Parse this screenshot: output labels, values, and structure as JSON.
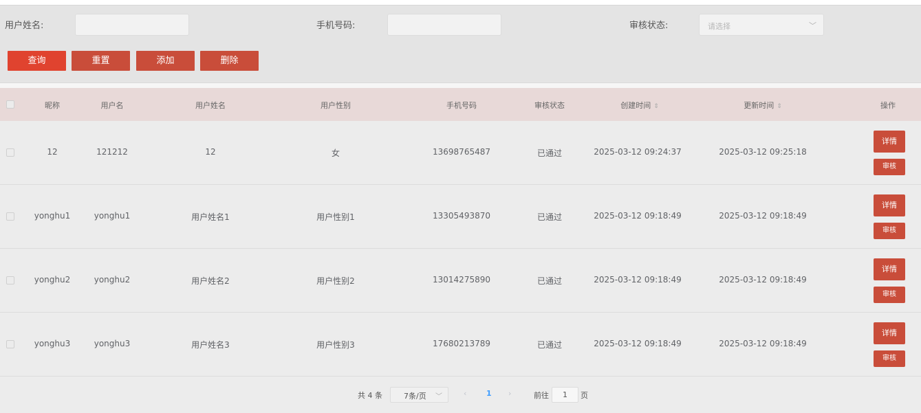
{
  "filters": {
    "username_label": "用户姓名:",
    "phone_label": "手机号码:",
    "status_label": "审核状态:",
    "status_placeholder": "请选择"
  },
  "buttons": {
    "query": "查询",
    "reset": "重置",
    "add": "添加",
    "delete": "删除"
  },
  "table": {
    "headers": {
      "nickname": "昵称",
      "username": "用户名",
      "realname": "用户姓名",
      "gender": "用户性别",
      "phone": "手机号码",
      "status": "审核状态",
      "created": "创建时间",
      "updated": "更新时间",
      "ops": "操作"
    },
    "sort_icon": "⇕",
    "detail_label": "详情",
    "audit_label": "审核",
    "rows": [
      {
        "nickname": "12",
        "username": "121212",
        "realname": "12",
        "gender": "女",
        "phone": "13698765487",
        "status": "已通过",
        "created": "2025-03-12 09:24:37",
        "updated": "2025-03-12 09:25:18"
      },
      {
        "nickname": "yonghu1",
        "username": "yonghu1",
        "realname": "用户姓名1",
        "gender": "用户性别1",
        "phone": "13305493870",
        "status": "已通过",
        "created": "2025-03-12 09:18:49",
        "updated": "2025-03-12 09:18:49"
      },
      {
        "nickname": "yonghu2",
        "username": "yonghu2",
        "realname": "用户姓名2",
        "gender": "用户性别2",
        "phone": "13014275890",
        "status": "已通过",
        "created": "2025-03-12 09:18:49",
        "updated": "2025-03-12 09:18:49"
      },
      {
        "nickname": "yonghu3",
        "username": "yonghu3",
        "realname": "用户姓名3",
        "gender": "用户性别3",
        "phone": "17680213789",
        "status": "已通过",
        "created": "2025-03-12 09:18:49",
        "updated": "2025-03-12 09:18:49"
      }
    ]
  },
  "pagination": {
    "total_text": "共 4 条",
    "page_size": "7条/页",
    "prev": "‹",
    "current_page": "1",
    "next": "›",
    "goto_label": "前往",
    "goto_value": "1",
    "page_unit": "页"
  },
  "colors": {
    "button": "#c94d3a",
    "primary_button": "#e0432f",
    "header_bg": "#e8d9d8",
    "active_page": "#409eff"
  }
}
